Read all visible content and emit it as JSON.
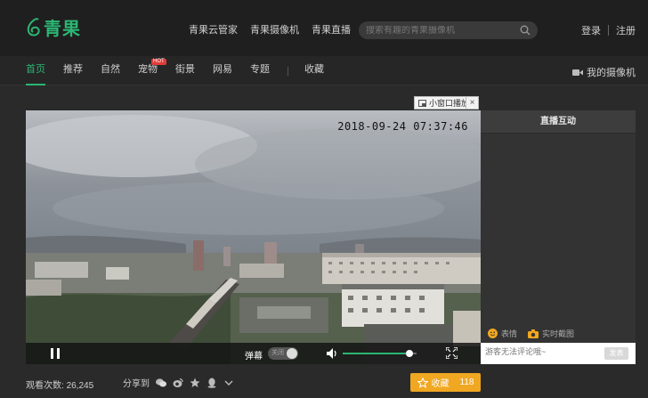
{
  "brand": {
    "logo_text": "青果",
    "accent": "#2bb673"
  },
  "top_nav": [
    "青果云管家",
    "青果摄像机",
    "青果直播"
  ],
  "search": {
    "placeholder": "搜索有趣的青果摄像机"
  },
  "auth": {
    "login": "登录",
    "register": "注册"
  },
  "categories": {
    "items": [
      "首页",
      "推荐",
      "自然",
      "宠物",
      "街景",
      "网易",
      "专题"
    ],
    "hot_badge": "HOT",
    "favorites": "收藏",
    "my_camera": "我的摄像机"
  },
  "mini_player": {
    "label": "小窗口播放",
    "close": "×"
  },
  "video": {
    "timestamp": "2018-09-24 07:37:46",
    "danmu_label": "弹幕",
    "danmu_state": "关闭",
    "volume_level": 0.9
  },
  "side_panel": {
    "title": "直播互动",
    "emoji_label": "表情",
    "screenshot_label": "实时截图",
    "comment_placeholder": "游客无法评论哦~",
    "send_label": "发表"
  },
  "footer": {
    "views_label": "观看次数:",
    "views_count": "26,245",
    "share_label": "分享到",
    "fav_label": "收藏",
    "fav_count": "118"
  },
  "colors": {
    "fav_button": "#f0a722",
    "hot_badge": "#e23b3b"
  }
}
